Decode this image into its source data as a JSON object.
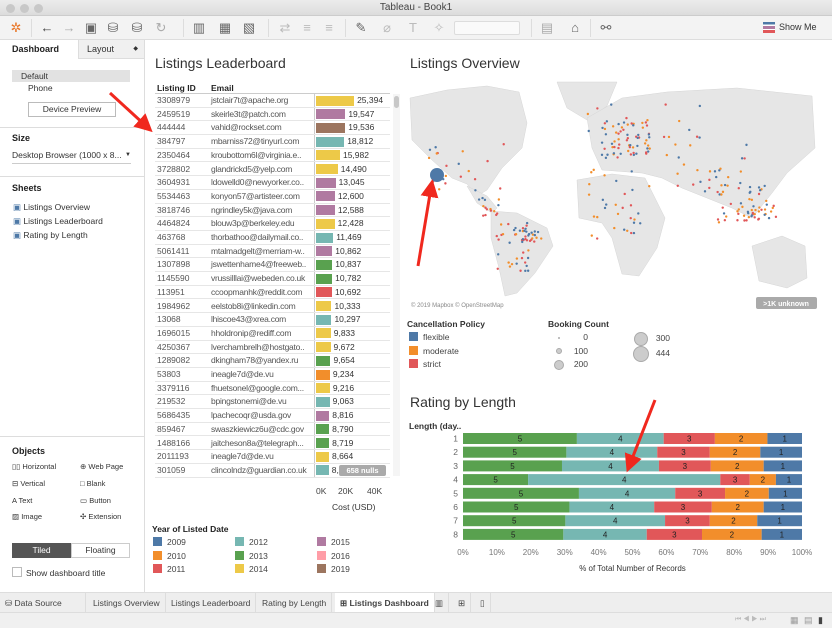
{
  "window": {
    "title": "Tableau - Book1"
  },
  "toolbar": {
    "show_me": "Show Me"
  },
  "left": {
    "tabs": [
      "Dashboard",
      "Layout"
    ],
    "devices": [
      "Default",
      "Phone"
    ],
    "device_preview": "Device Preview",
    "size_heading": "Size",
    "size_value": "Desktop Browser (1000 x 8...",
    "sheets_heading": "Sheets",
    "sheets": [
      "Listings Overview",
      "Listings Leaderboard",
      "Rating by Length"
    ],
    "objects_heading": "Objects",
    "objects": [
      "Horizontal",
      "Web Page",
      "Vertical",
      "Blank",
      "Text",
      "Button",
      "Image",
      "Extension"
    ],
    "tiled": "Tiled",
    "floating": "Floating",
    "show_title": "Show dashboard title"
  },
  "leaderboard": {
    "title": "Listings Leaderboard",
    "columns": [
      "Listing ID",
      "Email"
    ],
    "rows": [
      [
        "3308979",
        "jstclair7t@apache.org",
        25394,
        "2014"
      ],
      [
        "2459519",
        "skeirle3t@patch.com",
        19547,
        "2015"
      ],
      [
        "444444",
        "vahid@rockset.com",
        19536,
        "2019"
      ],
      [
        "384797",
        "mbarniss72@tinyurl.com",
        18812,
        "2012"
      ],
      [
        "2350464",
        "kroubottom6l@virginia.e..",
        15982,
        "2014"
      ],
      [
        "3728802",
        "glandrickd5@yelp.com",
        14490,
        "2014"
      ],
      [
        "3604931",
        "ldowelld0@newyorker.co..",
        13045,
        "2015"
      ],
      [
        "5534463",
        "konyon57@artisteer.com",
        12600,
        "2015"
      ],
      [
        "3818746",
        "ngrindley5k@java.com",
        12588,
        "2015"
      ],
      [
        "4464824",
        "blouw3p@berkeley.edu",
        12428,
        "2014"
      ],
      [
        "463768",
        "thorbathoo@dailymail.co..",
        11469,
        "2012"
      ],
      [
        "5061411",
        "mtalmadgelt@merriam-w..",
        10862,
        "2015"
      ],
      [
        "1307898",
        "jswettenhame4@freeweb..",
        10837,
        "2013"
      ],
      [
        "1145590",
        "vrussilllai@webeden.co.uk",
        10782,
        "2013"
      ],
      [
        "113951",
        "ccoopmanhk@reddit.com",
        10692,
        "2011"
      ],
      [
        "1984962",
        "eelstob8i@linkedin.com",
        10333,
        "2014"
      ],
      [
        "13068",
        "lhiscoe43@xrea.com",
        10297,
        "2012"
      ],
      [
        "1696015",
        "hholdronip@rediff.com",
        9833,
        "2014"
      ],
      [
        "4250367",
        "lverchambrelh@hostgato..",
        9672,
        "2014"
      ],
      [
        "1289082",
        "dkingham78@yandex.ru",
        9654,
        "2013"
      ],
      [
        "53803",
        "ineagle7d@de.vu",
        9234,
        "2010"
      ],
      [
        "3379116",
        "fhuetsonel@google.com...",
        9216,
        "2014"
      ],
      [
        "219532",
        "bpingstonemi@de.vu",
        9063,
        "2012"
      ],
      [
        "5686435",
        "lpachecoqr@usda.gov",
        8816,
        "2015"
      ],
      [
        "859467",
        "swaszkiewicz6u@cdc.gov",
        8790,
        "2013"
      ],
      [
        "1488166",
        "jaitcheson8a@telegraph...",
        8719,
        "2013"
      ],
      [
        "2011193",
        "ineagle7d@de.vu",
        8664,
        "2014"
      ],
      [
        "301059",
        "clincolndz@guardian.co.uk",
        8500,
        "2012"
      ]
    ],
    "nulls_badge": "658 nulls",
    "axis_ticks": [
      "0K",
      "20K",
      "40K"
    ],
    "axis_title": "Cost (USD)"
  },
  "year_legend": {
    "title": "Year of Listed Date",
    "items": [
      {
        "label": "2009",
        "color": "#4e79a7"
      },
      {
        "label": "2010",
        "color": "#f28e2b"
      },
      {
        "label": "2011",
        "color": "#e15759"
      },
      {
        "label": "2012",
        "color": "#76b7b2"
      },
      {
        "label": "2013",
        "color": "#59a14f"
      },
      {
        "label": "2014",
        "color": "#edc948"
      },
      {
        "label": "2015",
        "color": "#b07aa1"
      },
      {
        "label": "2016",
        "color": "#ff9da7"
      },
      {
        "label": "2019",
        "color": "#9c755f"
      }
    ]
  },
  "overview": {
    "title": "Listings Overview",
    "attribution": "© 2019 Mapbox © OpenStreetMap",
    "unknown_badge": ">1K unknown"
  },
  "cancel_legend": {
    "title": "Cancellation Policy",
    "items": [
      {
        "label": "flexible",
        "color": "#4e79a7"
      },
      {
        "label": "moderate",
        "color": "#f28e2b"
      },
      {
        "label": "strict",
        "color": "#e15759"
      }
    ]
  },
  "booking_legend": {
    "title": "Booking Count",
    "items": [
      "0",
      "100",
      "200",
      "300",
      "444"
    ]
  },
  "chart_data": {
    "type": "bar",
    "stacked": true,
    "orientation": "horizontal",
    "title": "Rating by Length",
    "ylabel": "Length (day..",
    "xlabel": "% of Total Number of Records",
    "categories": [
      "1",
      "2",
      "3",
      "4",
      "5",
      "6",
      "7",
      "8"
    ],
    "xticks": [
      "0%",
      "10%",
      "20%",
      "30%",
      "40%",
      "50%",
      "60%",
      "70%",
      "80%",
      "90%",
      "100%"
    ],
    "xlim": [
      0,
      100
    ],
    "series": [
      {
        "name": "5",
        "color": "#59a14f",
        "values": [
          33.6,
          30.5,
          29.2,
          19.2,
          34.2,
          31.4,
          30.2,
          29.6
        ]
      },
      {
        "name": "4",
        "color": "#76b7b2",
        "values": [
          25.6,
          26.8,
          28.6,
          56.7,
          28.4,
          25.0,
          29.4,
          24.6
        ]
      },
      {
        "name": "3",
        "color": "#e15759",
        "values": [
          15.1,
          15.5,
          15.3,
          8.7,
          14.7,
          17.0,
          13.2,
          16.3
        ]
      },
      {
        "name": "2",
        "color": "#f28e2b",
        "values": [
          15.5,
          14.9,
          15.6,
          7.7,
          12.9,
          15.3,
          14.0,
          17.6
        ]
      },
      {
        "name": "1",
        "color": "#4e79a7",
        "values": [
          10.2,
          12.3,
          11.3,
          7.7,
          9.8,
          11.3,
          13.2,
          11.9
        ]
      }
    ]
  },
  "sheet_tabs": {
    "data_source": "Data Source",
    "tabs": [
      "Listings Overview",
      "Listings Leaderboard",
      "Rating by Length",
      "Listings Dashboard"
    ],
    "active": "Listings Dashboard"
  }
}
